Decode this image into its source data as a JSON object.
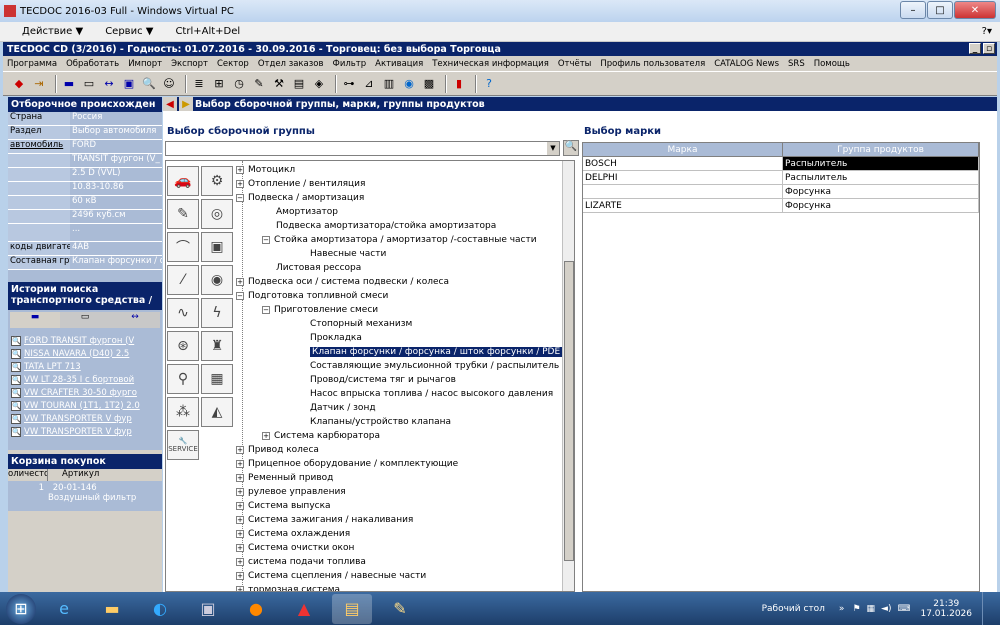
{
  "window": {
    "title": "TECDOC 2016-03 Full - Windows Virtual PC"
  },
  "vpc_menu": [
    "Действие ▼",
    "Сервис ▼",
    "Ctrl+Alt+Del"
  ],
  "app": {
    "title": "TECDOC CD (3/2016)  -  Годность: 01.07.2016 - 30.09.2016  -  Торговец: без выбора Торговца"
  },
  "app_menu": [
    "Программа",
    "Обработать",
    "Импорт",
    "Экспорт",
    "Сектор",
    "Отдел заказов",
    "Фильтр",
    "Активация",
    "Техническая информация",
    "Отчёты",
    "Профиль пользователя",
    "CATALOG News",
    "SRS",
    "Помощь"
  ],
  "left": {
    "filter_header": "Отборочное происхожден",
    "rows": [
      {
        "k": "Страна",
        "v": "Россия"
      },
      {
        "k": "Раздел",
        "v": "Выбор автомобиля"
      },
      {
        "k": "автомобиль",
        "v": "FORD"
      },
      {
        "k": "",
        "v": "TRANSIT фургон (V_"
      },
      {
        "k": "",
        "v": "2.5 D (VVL)"
      },
      {
        "k": "",
        "v": "10.83-10.86"
      },
      {
        "k": "",
        "v": "60 кВ"
      },
      {
        "k": "",
        "v": "2496 куб.см"
      },
      {
        "k": "",
        "v": "..."
      },
      {
        "k": "коды двигател",
        "v": "4AB"
      },
      {
        "k": "Составная гру",
        "v": "Клапан форсунки / фо"
      }
    ],
    "history_header": "Истории поиска транспортного средства /",
    "history": [
      "FORD TRANSIT фургон (V",
      "NISSA NAVARA (D40) 2.5",
      "TATA LPT 713",
      "VW LT 28-35 I c бортовой",
      "VW CRAFTER 30-50 фурго",
      "VW TOURAN (1T1, 1T2) 2.0",
      "VW TRANSPORTER V фур",
      "VW TRANSPORTER V фур"
    ],
    "cart_header": "Корзина покупок",
    "cart_cols": [
      "оличесто",
      "Артикул"
    ],
    "cart": {
      "qty": "1",
      "article": "20-01-146",
      "desc": "Воздушный фильтр"
    }
  },
  "main": {
    "header": "Выбор сборочной группы, марки, группы продуктов",
    "assembly_title": "Выбор сборочной группы",
    "brand_title": "Выбор марки",
    "tree": [
      {
        "t": "Мотоцикл",
        "l": 0,
        "pm": "+"
      },
      {
        "t": "Отопление / вентиляция",
        "l": 0,
        "pm": "+"
      },
      {
        "t": "Подвеска / амортизация",
        "l": 0,
        "pm": "−"
      },
      {
        "t": "Амортизатор",
        "l": 1
      },
      {
        "t": "Подвеска амортизатора/стойка амортизатора",
        "l": 1
      },
      {
        "t": "Стойка амортизатора / амортизатор /-составные части",
        "l": 1,
        "pm": "−"
      },
      {
        "t": "Навесные части",
        "l": 2
      },
      {
        "t": "Листовая рессора",
        "l": 1
      },
      {
        "t": "Подвеска оси / система подвески / колеса",
        "l": 0,
        "pm": "+"
      },
      {
        "t": "Подготовка топливной смеси",
        "l": 0,
        "pm": "−"
      },
      {
        "t": "Приготовление смеси",
        "l": 1,
        "pm": "−"
      },
      {
        "t": "Стопорный механизм",
        "l": 2
      },
      {
        "t": "Прокладка",
        "l": 2
      },
      {
        "t": "Клапан форсунки / форсунка / шток форсунки / PDE",
        "l": 2,
        "sel": true
      },
      {
        "t": "Составляющие эмульсионной трубки / распылитель",
        "l": 2
      },
      {
        "t": "Провод/система тяг и рычагов",
        "l": 2
      },
      {
        "t": "Насос впрыска топлива / насос высокого давления",
        "l": 2
      },
      {
        "t": "Датчик / зонд",
        "l": 2
      },
      {
        "t": "Клапаны/устройство клапана",
        "l": 2
      },
      {
        "t": "Система карбюратора",
        "l": 1,
        "pm": "+"
      },
      {
        "t": "Привод колеса",
        "l": 0,
        "pm": "+"
      },
      {
        "t": "Прицепное оборудование / комплектующие",
        "l": 0,
        "pm": "+"
      },
      {
        "t": "Ременный привод",
        "l": 0,
        "pm": "+"
      },
      {
        "t": "рулевое управления",
        "l": 0,
        "pm": "+"
      },
      {
        "t": "Система выпуска",
        "l": 0,
        "pm": "+"
      },
      {
        "t": "Система зажигания / накаливания",
        "l": 0,
        "pm": "+"
      },
      {
        "t": "Система охлаждения",
        "l": 0,
        "pm": "+"
      },
      {
        "t": "Система очистки окон",
        "l": 0,
        "pm": "+"
      },
      {
        "t": "система подачи топлива",
        "l": 0,
        "pm": "+"
      },
      {
        "t": "Система сцепления / навесные части",
        "l": 0,
        "pm": "+"
      },
      {
        "t": "тормозная система",
        "l": 0,
        "pm": "+"
      }
    ],
    "brand_cols": [
      "Марка",
      "Группа продуктов"
    ],
    "brands": [
      {
        "m": "BOSCH",
        "g": "Распылитель",
        "sel": true
      },
      {
        "m": "DELPHI",
        "g": "Распылитель"
      },
      {
        "m": "",
        "g": "Форсунка"
      },
      {
        "m": "LIZARTE",
        "g": "Форсунка"
      }
    ]
  },
  "taskbar": {
    "desktop": "Рабочий стол",
    "time": "21:39",
    "date": "17.01.2026"
  }
}
